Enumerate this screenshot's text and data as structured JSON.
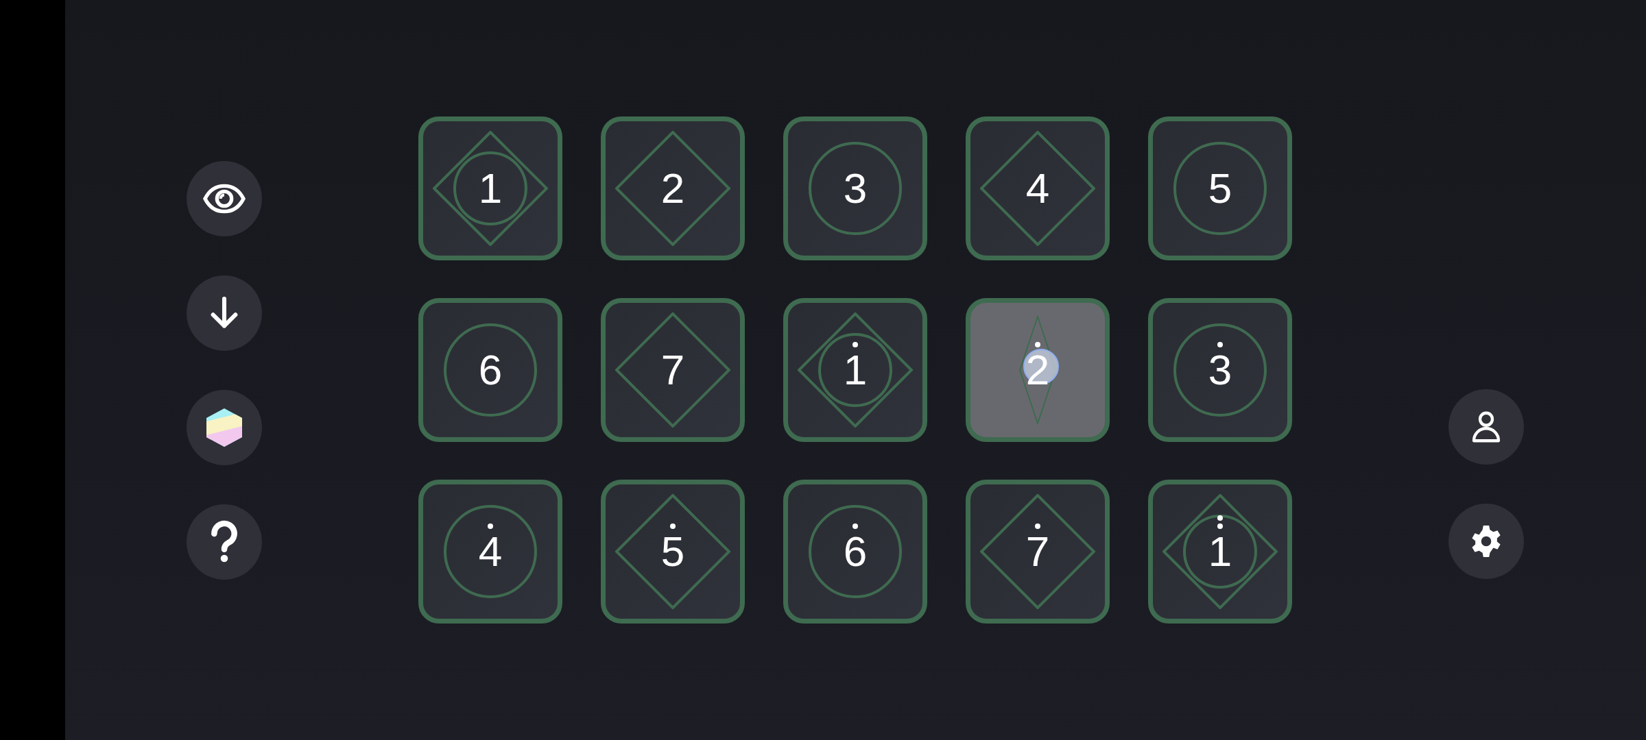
{
  "pads": [
    {
      "digit": "1",
      "dotted": false,
      "double_dotted": false,
      "kind": "both",
      "pressed": false
    },
    {
      "digit": "2",
      "dotted": false,
      "double_dotted": false,
      "kind": "diamond",
      "pressed": false
    },
    {
      "digit": "3",
      "dotted": false,
      "double_dotted": false,
      "kind": "circle",
      "pressed": false
    },
    {
      "digit": "4",
      "dotted": false,
      "double_dotted": false,
      "kind": "diamond",
      "pressed": false
    },
    {
      "digit": "5",
      "dotted": false,
      "double_dotted": false,
      "kind": "circle",
      "pressed": false
    },
    {
      "digit": "6",
      "dotted": false,
      "double_dotted": false,
      "kind": "circle",
      "pressed": false
    },
    {
      "digit": "7",
      "dotted": false,
      "double_dotted": false,
      "kind": "diamond",
      "pressed": false
    },
    {
      "digit": "1",
      "dotted": true,
      "double_dotted": false,
      "kind": "both",
      "pressed": false
    },
    {
      "digit": "2",
      "dotted": true,
      "double_dotted": false,
      "kind": "diamond",
      "pressed": true
    },
    {
      "digit": "3",
      "dotted": true,
      "double_dotted": false,
      "kind": "circle",
      "pressed": false
    },
    {
      "digit": "4",
      "dotted": true,
      "double_dotted": false,
      "kind": "circle",
      "pressed": false
    },
    {
      "digit": "5",
      "dotted": true,
      "double_dotted": false,
      "kind": "diamond",
      "pressed": false
    },
    {
      "digit": "6",
      "dotted": true,
      "double_dotted": false,
      "kind": "circle",
      "pressed": false
    },
    {
      "digit": "7",
      "dotted": true,
      "double_dotted": false,
      "kind": "diamond",
      "pressed": false
    },
    {
      "digit": "1",
      "dotted": true,
      "double_dotted": true,
      "kind": "both",
      "pressed": false
    }
  ]
}
